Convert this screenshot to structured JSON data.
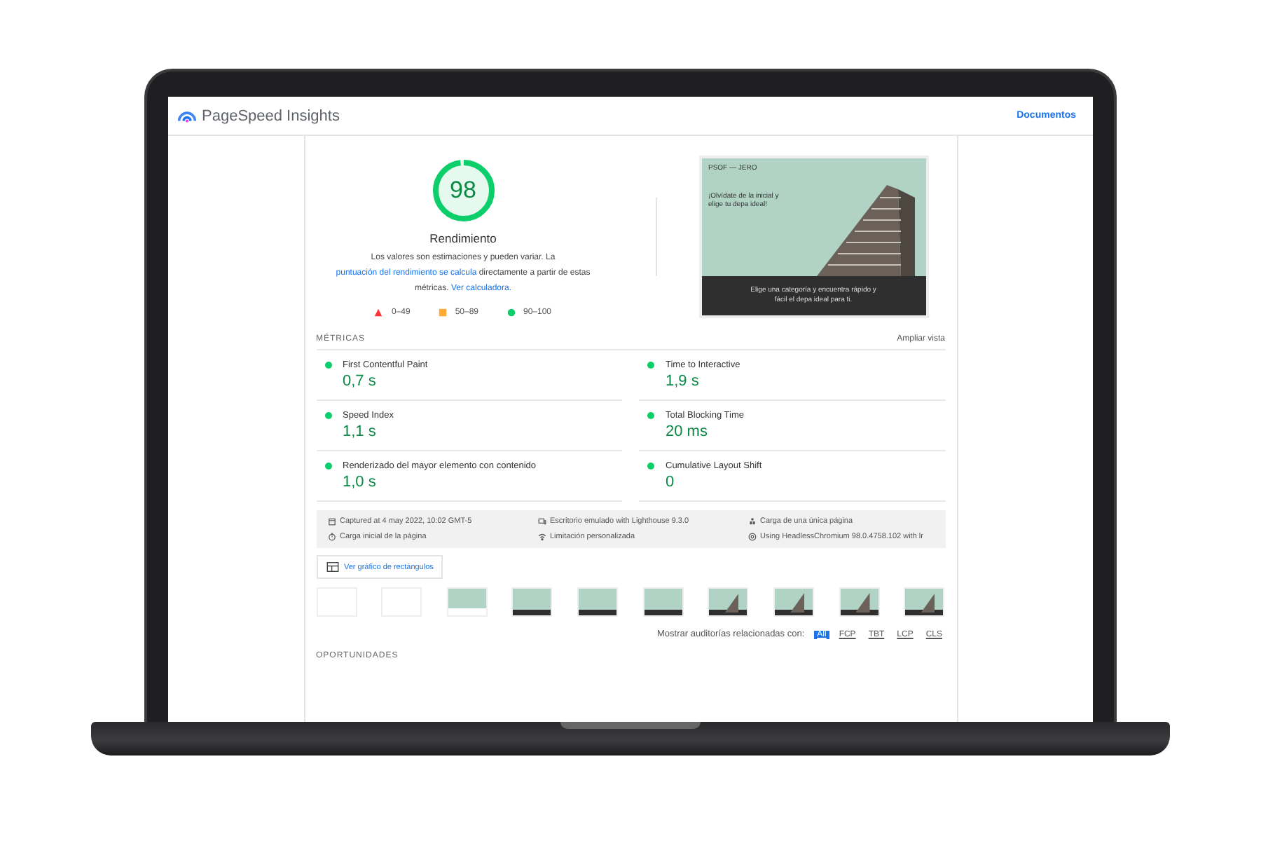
{
  "header": {
    "title": "PageSpeed Insights",
    "docs_link": "Documentos"
  },
  "score": {
    "value": "98",
    "level": 0.98,
    "label": "Rendimiento",
    "note_before": "Los valores son estimaciones y pueden variar. La ",
    "note_link1": "puntuación del rendimiento se calcula",
    "note_middle": " directamente a partir de estas métricas. ",
    "note_link2": "Ver calculadora."
  },
  "legend": [
    {
      "kind": "triangle",
      "range": "0–49",
      "color": "#ff3333"
    },
    {
      "kind": "square",
      "range": "50–89",
      "color": "#ffaa33"
    },
    {
      "kind": "circle",
      "range": "90–100",
      "color": "#0cce6b"
    }
  ],
  "preview": {
    "logo": "PSOF — JERO",
    "headline": "¡Olvídate de la inicial y elige tu depa ideal!",
    "footer_text": "Elige una categoría y encuentra rápido y fácil el depa ideal para ti."
  },
  "metrics": {
    "title": "MÉTRICAS",
    "expand": "Ampliar vista",
    "items": [
      {
        "name": "First Contentful Paint",
        "value": "0,7 s",
        "color": "#0cce6b"
      },
      {
        "name": "Time to Interactive",
        "value": "1,9 s",
        "color": "#0cce6b"
      },
      {
        "name": "Speed Index",
        "value": "1,1 s",
        "color": "#0cce6b"
      },
      {
        "name": "Total Blocking Time",
        "value": "20 ms",
        "color": "#0cce6b"
      },
      {
        "name": "Renderizado del mayor elemento con contenido",
        "value": "1,0 s",
        "color": "#0cce6b"
      },
      {
        "name": "Cumulative Layout Shift",
        "value": "0",
        "color": "#0cce6b"
      }
    ]
  },
  "run_info": [
    {
      "kind": "calendar",
      "text": "Captured at 4 may 2022, 10:02 GMT-5"
    },
    {
      "kind": "device",
      "text": "Escritorio emulado with Lighthouse 9.3.0"
    },
    {
      "kind": "person",
      "text": "Carga de una única página"
    },
    {
      "kind": "timer",
      "text": "Carga inicial de la página"
    },
    {
      "kind": "wifi",
      "text": "Limitación personalizada"
    },
    {
      "kind": "globe",
      "text": "Using HeadlessChromium 98.0.4758.102 with lr"
    }
  ],
  "treemap_button": "Ver gráfico de rectángulos",
  "filmstrip": [
    {
      "kind": "blank"
    },
    {
      "kind": "outline"
    },
    {
      "kind": "partial"
    },
    {
      "kind": "full"
    },
    {
      "kind": "full"
    },
    {
      "kind": "full"
    },
    {
      "kind": "building"
    },
    {
      "kind": "building"
    },
    {
      "kind": "building"
    },
    {
      "kind": "building"
    }
  ],
  "audit_filter": {
    "label": "Mostrar auditorías relacionadas con:",
    "chips": [
      {
        "label": "All",
        "selected": true
      },
      {
        "label": "FCP",
        "selected": false
      },
      {
        "label": "TBT",
        "selected": false
      },
      {
        "label": "LCP",
        "selected": false
      },
      {
        "label": "CLS",
        "selected": false
      }
    ]
  },
  "opportunities_title": "OPORTUNIDADES"
}
